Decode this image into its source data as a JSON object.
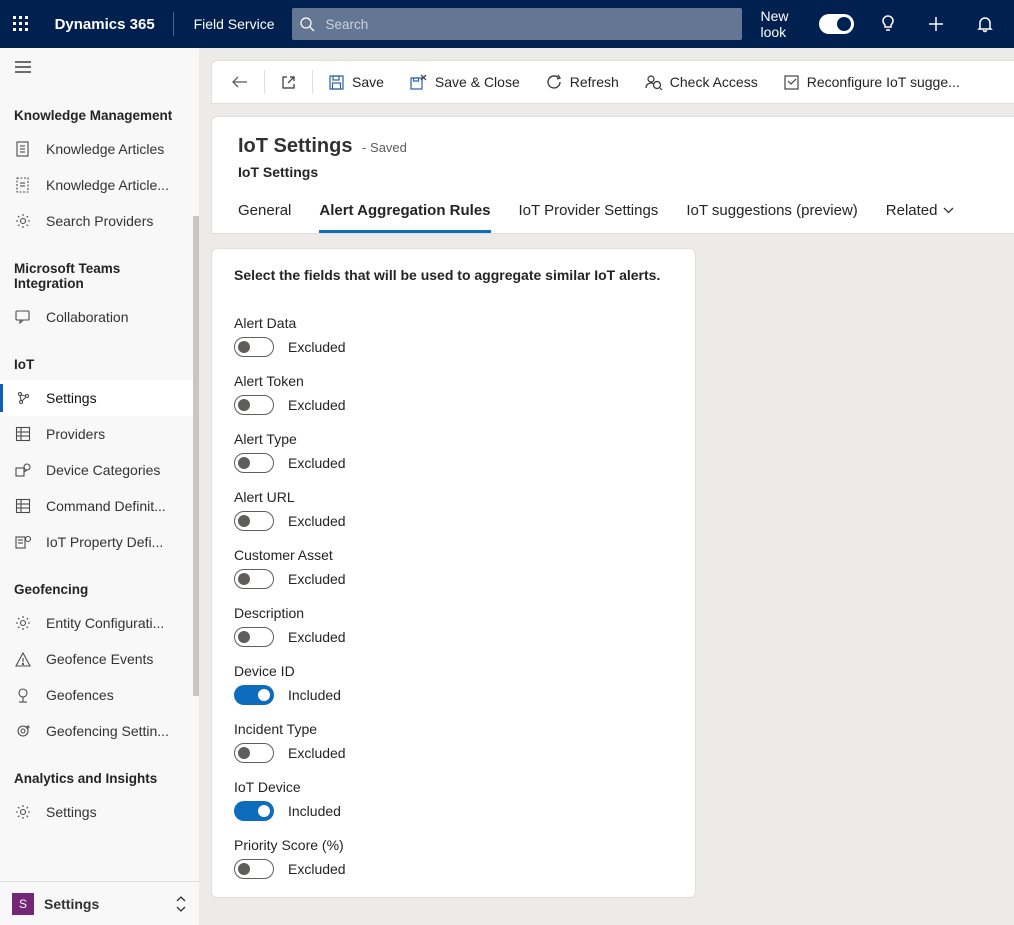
{
  "header": {
    "brand": "Dynamics 365",
    "app_name": "Field Service",
    "search_placeholder": "Search",
    "new_look": "New look"
  },
  "toolbar": {
    "save": "Save",
    "save_close": "Save & Close",
    "refresh": "Refresh",
    "check_access": "Check Access",
    "reconfigure": "Reconfigure IoT sugge..."
  },
  "record": {
    "title": "IoT Settings",
    "saved": "- Saved",
    "subtitle": "IoT Settings",
    "tabs": {
      "general": "General",
      "aggregation": "Alert Aggregation Rules",
      "provider": "IoT Provider Settings",
      "suggestions": "IoT suggestions (preview)",
      "related": "Related"
    }
  },
  "panel": {
    "instruction": "Select the fields that will be used to aggregate similar IoT alerts.",
    "excluded": "Excluded",
    "included": "Included",
    "fields": [
      {
        "label": "Alert Data",
        "on": false
      },
      {
        "label": "Alert Token",
        "on": false
      },
      {
        "label": "Alert Type",
        "on": false
      },
      {
        "label": "Alert URL",
        "on": false
      },
      {
        "label": "Customer Asset",
        "on": false
      },
      {
        "label": "Description",
        "on": false
      },
      {
        "label": "Device ID",
        "on": true
      },
      {
        "label": "Incident Type",
        "on": false
      },
      {
        "label": "IoT Device",
        "on": true
      },
      {
        "label": "Priority Score (%)",
        "on": false
      }
    ]
  },
  "sidebar": {
    "groups": [
      {
        "title": "Knowledge Management",
        "items": [
          {
            "label": "Knowledge Articles",
            "icon": "doc",
            "active": false
          },
          {
            "label": "Knowledge Article...",
            "icon": "doc-dashed",
            "active": false
          },
          {
            "label": "Search Providers",
            "icon": "gear",
            "active": false
          }
        ]
      },
      {
        "title": "Microsoft Teams Integration",
        "items": [
          {
            "label": "Collaboration",
            "icon": "chat",
            "active": false
          }
        ]
      },
      {
        "title": "IoT",
        "items": [
          {
            "label": "Settings",
            "icon": "iot-settings",
            "active": true
          },
          {
            "label": "Providers",
            "icon": "grid-doc",
            "active": false
          },
          {
            "label": "Device Categories",
            "icon": "device-cat",
            "active": false
          },
          {
            "label": "Command Definit...",
            "icon": "grid-doc",
            "active": false
          },
          {
            "label": "IoT Property Defi...",
            "icon": "property",
            "active": false
          }
        ]
      },
      {
        "title": "Geofencing",
        "items": [
          {
            "label": "Entity Configurati...",
            "icon": "gear",
            "active": false
          },
          {
            "label": "Geofence Events",
            "icon": "warn",
            "active": false
          },
          {
            "label": "Geofences",
            "icon": "pin",
            "active": false
          },
          {
            "label": "Geofencing Settin...",
            "icon": "target",
            "active": false
          }
        ]
      },
      {
        "title": "Analytics and Insights",
        "items": [
          {
            "label": "Settings",
            "icon": "gear",
            "active": false
          }
        ]
      }
    ]
  },
  "areaSwitcher": {
    "initial": "S",
    "label": "Settings"
  }
}
